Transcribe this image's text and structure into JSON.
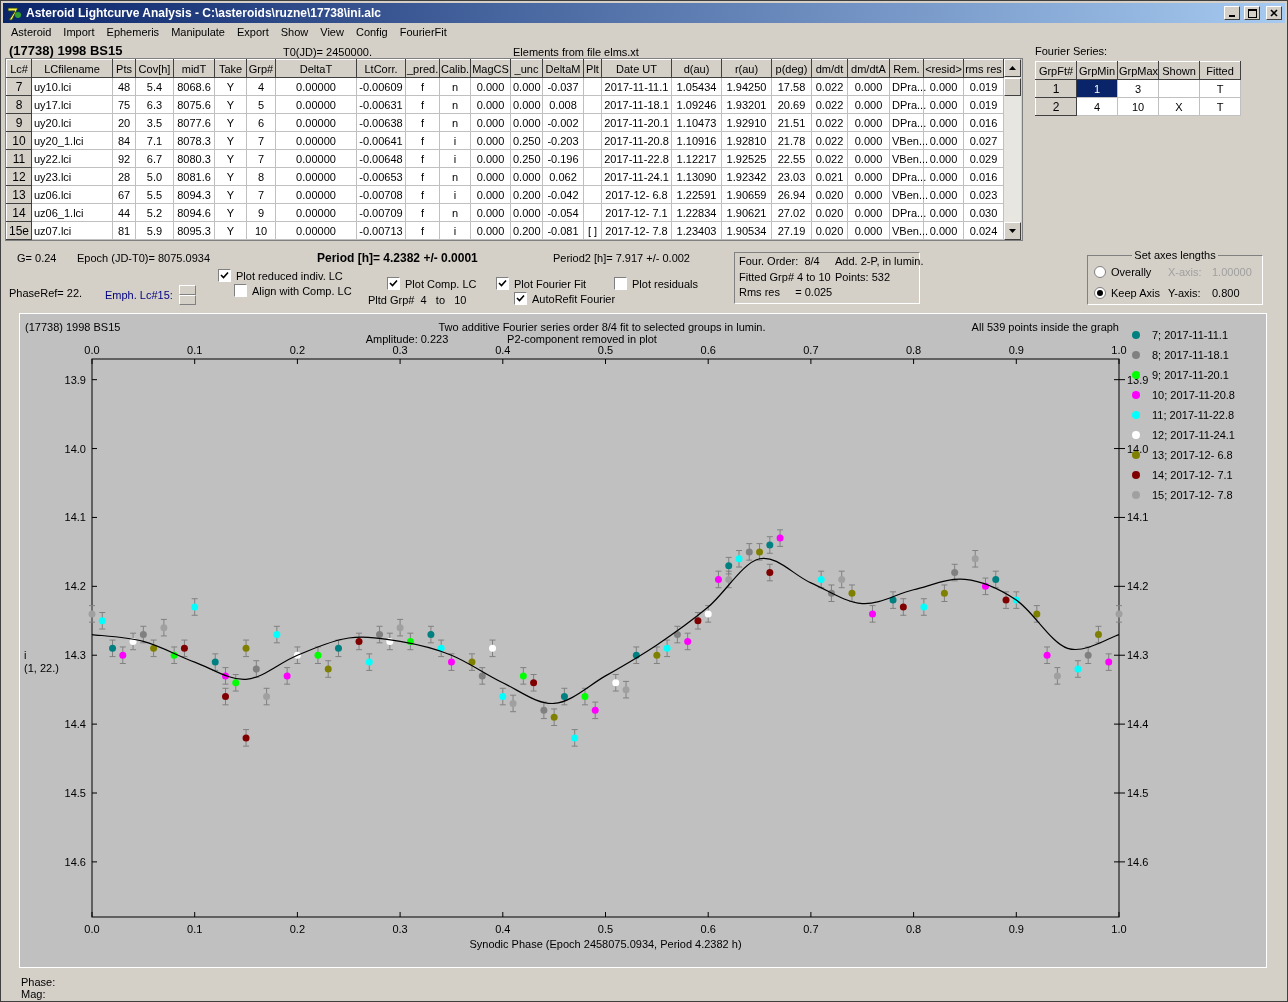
{
  "window": {
    "title": "Asteroid Lightcurve Analysis - C:\\asteroids\\ruzne\\17738\\ini.alc"
  },
  "menu": [
    "Asteroid",
    "Import",
    "Ephemeris",
    "Manipulate",
    "Export",
    "Show",
    "View",
    "Config",
    "FourierFit"
  ],
  "header": {
    "object": "(17738) 1998 BS15",
    "t0": "T0(JD)= 2450000.",
    "elements": "Elements from file elms.xt"
  },
  "table": {
    "columns": [
      "Lc#",
      "LCfilename",
      "Pts",
      "Cov[h]",
      "midT",
      "Take",
      "Grp#",
      "DeltaT",
      "LtCorr.",
      "_pred.",
      "Calib.",
      "MagCS",
      "_unc",
      "DeltaM",
      "Plt",
      "Date UT",
      "d(au)",
      "r(au)",
      "p(deg)",
      "dm/dt",
      "dm/dtA",
      "Rem.",
      "<resid>",
      "rms res"
    ],
    "rows": [
      {
        "cells": [
          "7",
          "uy10.lci",
          "48",
          "5.4",
          "8068.6",
          "Y",
          "4",
          "0.00000",
          "-0.00609",
          "f",
          "n",
          "0.000",
          "0.000",
          "-0.037",
          null,
          "2017-11-11.1",
          "1.05434",
          "1.94250",
          "17.58",
          "0.022",
          "0.000",
          "DPra...",
          "0.000",
          "0.019"
        ]
      },
      {
        "cells": [
          "8",
          "uy17.lci",
          "75",
          "6.3",
          "8075.6",
          "Y",
          "5",
          "0.00000",
          "-0.00631",
          "f",
          "n",
          "0.000",
          "0.000",
          "0.008",
          null,
          "2017-11-18.1",
          "1.09246",
          "1.93201",
          "20.69",
          "0.022",
          "0.000",
          "DPra...",
          "0.000",
          "0.019"
        ]
      },
      {
        "cells": [
          "9",
          "uy20.lci",
          "20",
          "3.5",
          "8077.6",
          "Y",
          "6",
          "0.00000",
          "-0.00638",
          "f",
          "n",
          "0.000",
          "0.000",
          "-0.002",
          null,
          "2017-11-20.1",
          "1.10473",
          "1.92910",
          "21.51",
          "0.022",
          "0.000",
          "DPra...",
          "0.000",
          "0.016"
        ]
      },
      {
        "cells": [
          "10",
          "uy20_1.lci",
          "84",
          "7.1",
          "8078.3",
          "Y",
          "7",
          "0.00000",
          "-0.00641",
          "f",
          "i",
          "0.000",
          "0.250",
          "-0.203",
          null,
          "2017-11-20.8",
          "1.10916",
          "1.92810",
          "21.78",
          "0.022",
          "0.000",
          "VBen...",
          "0.000",
          "0.027"
        ]
      },
      {
        "cells": [
          "11",
          "uy22.lci",
          "92",
          "6.7",
          "8080.3",
          "Y",
          "7",
          "0.00000",
          "-0.00648",
          "f",
          "i",
          "0.000",
          "0.250",
          "-0.196",
          null,
          "2017-11-22.8",
          "1.12217",
          "1.92525",
          "22.55",
          "0.022",
          "0.000",
          "VBen...",
          "0.000",
          "0.029"
        ]
      },
      {
        "cells": [
          "12",
          "uy23.lci",
          "28",
          "5.0",
          "8081.6",
          "Y",
          "8",
          "0.00000",
          "-0.00653",
          "f",
          "n",
          "0.000",
          "0.000",
          "0.062",
          null,
          "2017-11-24.1",
          "1.13090",
          "1.92342",
          "23.03",
          "0.021",
          "0.000",
          "DPra...",
          "0.000",
          "0.016"
        ]
      },
      {
        "cells": [
          "13",
          "uz06.lci",
          "67",
          "5.5",
          "8094.3",
          "Y",
          "7",
          "0.00000",
          "-0.00708",
          "f",
          "i",
          "0.000",
          "0.200",
          "-0.042",
          null,
          "2017-12- 6.8",
          "1.22591",
          "1.90659",
          "26.94",
          "0.020",
          "0.000",
          "VBen...",
          "0.000",
          "0.023"
        ]
      },
      {
        "cells": [
          "14",
          "uz06_1.lci",
          "44",
          "5.2",
          "8094.6",
          "Y",
          "9",
          "0.00000",
          "-0.00709",
          "f",
          "n",
          "0.000",
          "0.000",
          "-0.054",
          null,
          "2017-12- 7.1",
          "1.22834",
          "1.90621",
          "27.02",
          "0.020",
          "0.000",
          "DPra...",
          "0.000",
          "0.030"
        ]
      },
      {
        "cells": [
          "15e",
          "uz07.lci",
          "81",
          "5.9",
          "8095.3",
          "Y",
          "10",
          "0.00000",
          "-0.00713",
          "f",
          "i",
          "0.000",
          "0.200",
          "-0.081",
          "[ ]",
          "2017-12- 7.8",
          "1.23403",
          "1.90534",
          "27.19",
          "0.020",
          "0.000",
          "VBen...",
          "0.000",
          "0.024"
        ]
      }
    ]
  },
  "fourier": {
    "title": "Fourier Series:",
    "columns": [
      "GrpFt#",
      "GrpMin",
      "GrpMax",
      "Shown",
      "Fitted"
    ],
    "rows": [
      {
        "cells": [
          {
            "text": "1",
            "selected": false
          },
          {
            "text": "1",
            "selected": true
          },
          {
            "text": "3",
            "selected": false
          },
          {
            "selected": false
          },
          {
            "text": "T",
            "selected": false
          }
        ]
      },
      {
        "cells": [
          {
            "text": "2",
            "selected": false
          },
          {
            "text": "4",
            "selected": false
          },
          {
            "text": "10",
            "selected": false
          },
          {
            "text": "X",
            "selected": false
          },
          {
            "text": "T",
            "selected": false
          }
        ]
      }
    ]
  },
  "stats": {
    "g": "G= 0.24",
    "epoch": "Epoch (JD-T0)= 8075.0934",
    "period": "Period [h]= 4.2382 +/- 0.0001",
    "period2": "Period2 [h]= 7.917 +/- 0.002",
    "phase_ref": "PhaseRef= 22.",
    "emph": "Emph. Lc#15:",
    "pltd": "Pltd Grp#  4   to   10"
  },
  "checkboxes": [
    {
      "label": "Plot reduced indiv. LC",
      "checked": true
    },
    {
      "label": "Align with Comp. LC",
      "checked": false
    },
    {
      "label": "Plot Comp. LC",
      "checked": true
    },
    {
      "label": "Plot Fourier Fit",
      "checked": true
    },
    {
      "label": "AutoRefit Fourier",
      "checked": true
    },
    {
      "label": "Plot residuals",
      "checked": false
    }
  ],
  "info_box": {
    "lines": [
      {
        "left": "Four. Order:  8/4",
        "right": "Add. 2-P, in lumin."
      },
      {
        "left": "Fitted Grp# 4 to 10",
        "right": "Points: 532"
      },
      {
        "left": "Rms res     = 0.025"
      }
    ]
  },
  "axes_group": {
    "title": "Set axes lengths",
    "radios": [
      {
        "label": "Overally",
        "selected": false
      },
      {
        "label": "Keep Axis",
        "selected": true
      }
    ],
    "fields": [
      {
        "label": "X-axis:",
        "value": "1.00000",
        "disabled": true
      },
      {
        "label": "Y-axis:",
        "value": "0.800",
        "disabled": false
      }
    ]
  },
  "plot": {
    "object": "(17738) 1998 BS15",
    "right_tick_labels": [
      "13.9",
      "14.0",
      "14.1",
      "14.2",
      "14.3",
      "14.4",
      "14.5",
      "14.6"
    ],
    "title": "Two additive Fourier series order 8/4 fit to selected groups in lumin.",
    "amplitude": "Amplitude: 0.223",
    "note": "P2-component removed in plot",
    "count": "All 539 points inside the graph",
    "ylabel_2": "(1, 22.)",
    "chart_data": {
      "type": "scatter",
      "legend": "right",
      "xlabel": "Synodic Phase (Epoch 2458075.0934, Period 4.2382 h)",
      "ylabel": "i",
      "xlim": [
        0,
        1
      ],
      "ylim": [
        14.68,
        13.87
      ],
      "xticks": [
        {
          "value": 0,
          "label": "0.0"
        },
        {
          "value": 0.1,
          "label": "0.1"
        },
        {
          "value": 0.2,
          "label": "0.2"
        },
        {
          "value": 0.3,
          "label": "0.3"
        },
        {
          "value": 0.4,
          "label": "0.4"
        },
        {
          "value": 0.5,
          "label": "0.5"
        },
        {
          "value": 0.6,
          "label": "0.6"
        },
        {
          "value": 0.7,
          "label": "0.7"
        },
        {
          "value": 0.8,
          "label": "0.8"
        },
        {
          "value": 0.9,
          "label": "0.9"
        },
        {
          "value": 1,
          "label": "1.0"
        }
      ],
      "yticks": [
        {
          "value": 13.9,
          "label": "13.9"
        },
        {
          "value": 14.0,
          "label": "14.0"
        },
        {
          "value": 14.1,
          "label": "14.1"
        },
        {
          "value": 14.2,
          "label": "14.2"
        },
        {
          "value": 14.3,
          "label": "14.3"
        },
        {
          "value": 14.4,
          "label": "14.4"
        },
        {
          "value": 14.5,
          "label": "14.5"
        },
        {
          "value": 14.6,
          "label": "14.6"
        }
      ],
      "series": [
        {
          "name": "7; 2017-11-11.1",
          "color": "#008080",
          "errors": [
            0.012,
            0.012,
            0.012,
            0.012,
            0.012,
            0.012,
            0.012,
            0.012,
            0.012,
            0.012
          ],
          "x": [
            0.02,
            0.12,
            0.24,
            0.33,
            0.46,
            0.53,
            0.62,
            0.66,
            0.78,
            0.88
          ],
          "values": [
            14.29,
            14.31,
            14.29,
            14.27,
            14.36,
            14.3,
            14.17,
            14.14,
            14.22,
            14.19
          ]
        },
        {
          "name": "8; 2017-11-18.1",
          "color": "#808080",
          "errors": [
            0.012,
            0.012,
            0.012,
            0.012,
            0.012,
            0.012,
            0.012,
            0.012,
            0.012,
            0.012
          ],
          "x": [
            0.05,
            0.16,
            0.28,
            0.38,
            0.44,
            0.57,
            0.64,
            0.72,
            0.84,
            0.97
          ],
          "values": [
            14.27,
            14.32,
            14.27,
            14.33,
            14.38,
            14.27,
            14.15,
            14.21,
            14.18,
            14.3
          ]
        },
        {
          "name": "9; 2017-11-20.1",
          "color": "#00ff00",
          "errors": [
            0.012,
            0.012,
            0.012,
            0.012,
            0.012,
            0.012
          ],
          "x": [
            0.08,
            0.14,
            0.22,
            0.31,
            0.42,
            0.48
          ],
          "values": [
            14.3,
            14.34,
            14.3,
            14.28,
            14.33,
            14.36
          ]
        },
        {
          "name": "10; 2017-11-20.8",
          "color": "#ff00ff",
          "errors": [
            0.012,
            0.012,
            0.012,
            0.012,
            0.012,
            0.012,
            0.012,
            0.012,
            0.012,
            0.012,
            0.012,
            0.012
          ],
          "x": [
            0.03,
            0.13,
            0.19,
            0.35,
            0.49,
            0.58,
            0.61,
            0.67,
            0.76,
            0.87,
            0.93,
            0.99
          ],
          "values": [
            14.3,
            14.33,
            14.33,
            14.31,
            14.38,
            14.28,
            14.19,
            14.13,
            14.24,
            14.2,
            14.3,
            14.31
          ]
        },
        {
          "name": "11; 2017-11-22.8",
          "color": "#00ffff",
          "errors": [
            0.012,
            0.012,
            0.012,
            0.012,
            0.012,
            0.012,
            0.012,
            0.012,
            0.012,
            0.012,
            0.012,
            0.012,
            0.012
          ],
          "x": [
            0.01,
            0.1,
            0.18,
            0.27,
            0.34,
            0.4,
            0.47,
            0.56,
            0.63,
            0.71,
            0.81,
            0.9,
            0.96
          ],
          "values": [
            14.25,
            14.23,
            14.27,
            14.31,
            14.29,
            14.36,
            14.42,
            14.29,
            14.16,
            14.19,
            14.23,
            14.22,
            14.32
          ]
        },
        {
          "name": "12; 2017-11-24.1",
          "color": "#ffffff",
          "errors": [
            0.012,
            0.012,
            0.012,
            0.012,
            0.012,
            0.012
          ],
          "x": [
            0.04,
            0.2,
            0.29,
            0.39,
            0.51,
            0.6
          ],
          "values": [
            14.28,
            14.3,
            14.28,
            14.29,
            14.34,
            14.24
          ]
        },
        {
          "name": "13; 2017-12- 6.8",
          "color": "#808000",
          "errors": [
            0.012,
            0.012,
            0.012,
            0.012,
            0.012,
            0.012,
            0.012,
            0.012,
            0.012,
            0.012,
            0.012
          ],
          "x": [
            0.06,
            0.15,
            0.23,
            0.37,
            0.45,
            0.55,
            0.65,
            0.74,
            0.83,
            0.92,
            0.98
          ],
          "values": [
            14.29,
            14.29,
            14.32,
            14.31,
            14.39,
            14.3,
            14.15,
            14.21,
            14.21,
            14.24,
            14.27
          ]
        },
        {
          "name": "14; 2017-12- 7.1",
          "color": "#800000",
          "errors": [
            0.012,
            0.012,
            0.012,
            0.012,
            0.012,
            0.012,
            0.012,
            0.012,
            0.012
          ],
          "x": [
            0.09,
            0.13,
            0.15,
            0.26,
            0.43,
            0.59,
            0.66,
            0.79,
            0.89
          ],
          "values": [
            14.29,
            14.36,
            14.42,
            14.28,
            14.34,
            14.25,
            14.18,
            14.23,
            14.22
          ]
        },
        {
          "name": "15; 2017-12- 7.8",
          "color": "#a0a0a0",
          "errors": [
            0.012,
            0.012,
            0.012,
            0.012,
            0.012,
            0.012,
            0.012,
            0.012,
            0.012,
            0.012,
            0.012
          ],
          "x": [
            0.0,
            0.07,
            0.17,
            0.3,
            0.41,
            0.52,
            0.62,
            0.73,
            0.86,
            0.94,
            1.0
          ],
          "values": [
            14.24,
            14.26,
            14.36,
            14.26,
            14.37,
            14.35,
            14.19,
            14.19,
            14.16,
            14.33,
            14.24
          ]
        },
        {
          "type": "line",
          "color": "#000000",
          "x": [
            0,
            0.05,
            0.1,
            0.15,
            0.2,
            0.25,
            0.3,
            0.35,
            0.4,
            0.45,
            0.5,
            0.55,
            0.6,
            0.65,
            0.7,
            0.75,
            0.8,
            0.85,
            0.9,
            0.95,
            1
          ],
          "values": [
            14.27,
            14.28,
            14.31,
            14.335,
            14.3,
            14.275,
            14.28,
            14.3,
            14.34,
            14.37,
            14.33,
            14.285,
            14.23,
            14.16,
            14.195,
            14.225,
            14.205,
            14.19,
            14.22,
            14.29,
            14.27
          ]
        }
      ]
    }
  },
  "status": {
    "phase": "Phase:",
    "mag": "Mag:"
  }
}
